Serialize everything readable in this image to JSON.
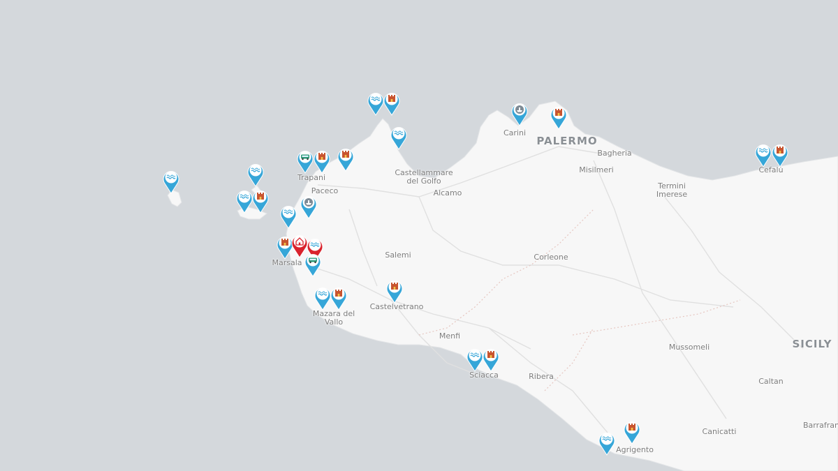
{
  "map": {
    "colors": {
      "sea": "#d4d8dc",
      "land": "#f7f7f7",
      "pin_blue": "#36a6d8",
      "pin_red": "#d9232d"
    },
    "place_labels": [
      {
        "id": "palermo",
        "text": "PALERMO"
      },
      {
        "id": "bagheria",
        "text": "Bagheria"
      },
      {
        "id": "carini",
        "text": "Carini"
      },
      {
        "id": "misilmeri",
        "text": "Misilmeri"
      },
      {
        "id": "termini",
        "text": "Termini\nImerese"
      },
      {
        "id": "cefalu",
        "text": "Cefalù"
      },
      {
        "id": "trapani",
        "text": "Trapani"
      },
      {
        "id": "paceco",
        "text": "Paceco"
      },
      {
        "id": "castellammare",
        "text": "Castellammare\ndel Golfo"
      },
      {
        "id": "alcamo",
        "text": "Alcamo"
      },
      {
        "id": "salemi",
        "text": "Salemi"
      },
      {
        "id": "marsala",
        "text": "Marsala"
      },
      {
        "id": "corleone",
        "text": "Corleone"
      },
      {
        "id": "castelvetrano",
        "text": "Castelvetrano"
      },
      {
        "id": "mazara",
        "text": "Mazara del\nVallo"
      },
      {
        "id": "menfi",
        "text": "Menfi"
      },
      {
        "id": "sciacca",
        "text": "Sciacca"
      },
      {
        "id": "ribera",
        "text": "Ribera"
      },
      {
        "id": "mussomeli",
        "text": "Mussomeli"
      },
      {
        "id": "sicily",
        "text": "SICILY"
      },
      {
        "id": "caltan",
        "text": "Caltan"
      },
      {
        "id": "canicatti",
        "text": "Canicatti"
      },
      {
        "id": "barrafran",
        "text": "Barrafran"
      },
      {
        "id": "agrigento",
        "text": "Agrigento"
      }
    ],
    "markers": [
      {
        "id": "m1",
        "icon": "wave-icon",
        "color": "blue"
      },
      {
        "id": "m2",
        "icon": "castle-icon",
        "color": "blue"
      },
      {
        "id": "m3",
        "icon": "wave-icon",
        "color": "blue"
      },
      {
        "id": "m4",
        "icon": "boat-icon",
        "color": "blue"
      },
      {
        "id": "m5",
        "icon": "castle-icon",
        "color": "blue"
      },
      {
        "id": "m6",
        "icon": "bus-icon",
        "color": "blue"
      },
      {
        "id": "m7",
        "icon": "castle-icon",
        "color": "blue"
      },
      {
        "id": "m8",
        "icon": "castle-icon",
        "color": "blue"
      },
      {
        "id": "m9",
        "icon": "wave-icon",
        "color": "blue"
      },
      {
        "id": "m10",
        "icon": "wave-icon",
        "color": "blue"
      },
      {
        "id": "m11",
        "icon": "wave-icon",
        "color": "blue"
      },
      {
        "id": "m12",
        "icon": "castle-icon",
        "color": "blue"
      },
      {
        "id": "m13",
        "icon": "wave-icon",
        "color": "blue"
      },
      {
        "id": "m14",
        "icon": "boat-icon",
        "color": "blue"
      },
      {
        "id": "m15",
        "icon": "castle-icon",
        "color": "blue"
      },
      {
        "id": "m16",
        "icon": "home-icon",
        "color": "red"
      },
      {
        "id": "m17",
        "icon": "wave-icon",
        "color": "red"
      },
      {
        "id": "m18",
        "icon": "bus-icon",
        "color": "blue"
      },
      {
        "id": "m19",
        "icon": "wave-icon",
        "color": "blue"
      },
      {
        "id": "m20",
        "icon": "castle-icon",
        "color": "blue"
      },
      {
        "id": "m21",
        "icon": "castle-icon",
        "color": "blue"
      },
      {
        "id": "m22",
        "icon": "wave-icon",
        "color": "blue"
      },
      {
        "id": "m23",
        "icon": "castle-icon",
        "color": "blue"
      },
      {
        "id": "m24",
        "icon": "wave-icon",
        "color": "blue"
      },
      {
        "id": "m25",
        "icon": "castle-icon",
        "color": "blue"
      },
      {
        "id": "m26",
        "icon": "wave-icon",
        "color": "blue"
      },
      {
        "id": "m27",
        "icon": "castle-icon",
        "color": "blue"
      }
    ]
  }
}
